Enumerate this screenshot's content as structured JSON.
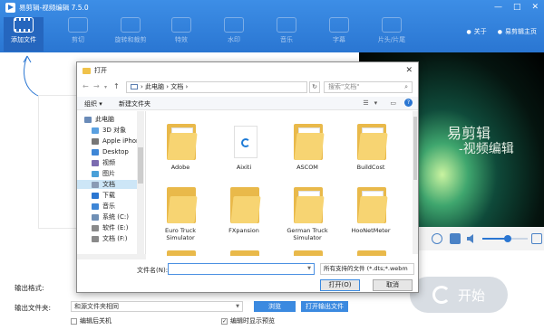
{
  "window": {
    "title": "易剪辑-视频编辑 7.5.0",
    "controls": [
      "—",
      "□",
      "✕"
    ]
  },
  "toolbar": {
    "items": [
      {
        "label": "添加文件",
        "icon": "film-icon"
      },
      {
        "label": "剪切",
        "icon": "scissors-icon"
      },
      {
        "label": "旋转和裁剪",
        "icon": "rotate-icon"
      },
      {
        "label": "特效",
        "icon": "effects-icon"
      },
      {
        "label": "水印",
        "icon": "watermark-icon"
      },
      {
        "label": "音乐",
        "icon": "music-icon"
      },
      {
        "label": "字幕",
        "icon": "subtitle-icon"
      },
      {
        "label": "片头/片尾",
        "icon": "intro-outro-icon"
      }
    ],
    "about": "关于",
    "about_logo": "易剪辑主页"
  },
  "preview": {
    "line1": "易剪辑",
    "line2": "-视频编辑",
    "volume_fraction": 0.55
  },
  "output": {
    "format_label": "输出格式:",
    "folder_label": "输出文件夹:",
    "folder_value": "和源文件夹相同",
    "browse": "浏览",
    "open_folder": "打开输出文件",
    "shutdown": "编辑后关机",
    "show_preview": "编辑时显示预览",
    "start": "开始"
  },
  "dialog": {
    "title": "打开",
    "path": [
      "此电脑",
      "文档"
    ],
    "search_placeholder": "搜索\"文档\"",
    "organize": "组织 ▾",
    "new_folder": "新建文件夹",
    "nav": [
      {
        "label": "此电脑",
        "color": "#6a8bb8"
      },
      {
        "label": "3D 对象",
        "color": "#5aa0e0"
      },
      {
        "label": "Apple iPhone",
        "color": "#777777"
      },
      {
        "label": "Desktop",
        "color": "#3e86d6"
      },
      {
        "label": "视频",
        "color": "#7b6bb0"
      },
      {
        "label": "图片",
        "color": "#4aa0d8"
      },
      {
        "label": "文档",
        "color": "#8a9bb5"
      },
      {
        "label": "下载",
        "color": "#2a76d2"
      },
      {
        "label": "音乐",
        "color": "#3e86d6"
      },
      {
        "label": "系统 (C:)",
        "color": "#6f8fb5"
      },
      {
        "label": "软件 (E:)",
        "color": "#8a8a8a"
      },
      {
        "label": "文档 (F:)",
        "color": "#8a8a8a"
      }
    ],
    "files": [
      "Adobe",
      "Aixiti",
      "ASCOM",
      "BuildCost",
      "Euro Truck Simulator",
      "FXpansion",
      "German Truck Simulator",
      "HooNetMeter"
    ],
    "filename_label": "文件名(N):",
    "filetype": "所有支持的文件 (*.dts;*.webm",
    "open": "打开(O)",
    "cancel": "取消"
  }
}
